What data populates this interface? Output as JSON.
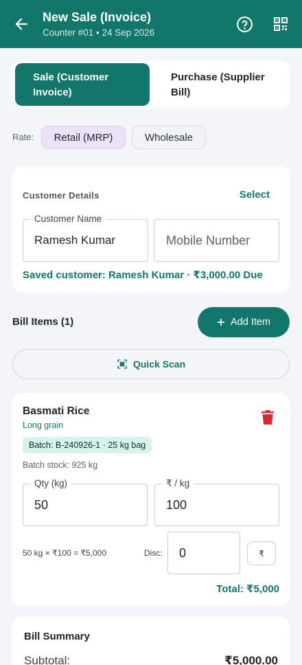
{
  "header": {
    "title": "New Sale (Invoice)",
    "subtitle": "Counter #01 • 24 Sep 2026",
    "icons": [
      "back-arrow-icon",
      "help-icon",
      "qr-code-icon"
    ]
  },
  "mode_tabs": [
    {
      "label": "Sale (Customer Invoice)",
      "active": true
    },
    {
      "label": "Purchase (Supplier Bill)",
      "active": false
    }
  ],
  "rate": {
    "label": "Rate:",
    "options": [
      {
        "label": "Retail (MRP)",
        "selected": true
      },
      {
        "label": "Wholesale",
        "selected": false
      }
    ]
  },
  "customer": {
    "section_title": "Customer Details",
    "select_label": "Select",
    "name_label": "Customer Name",
    "name_value": "Ramesh Kumar",
    "mobile_placeholder": "Mobile Number",
    "saved_text": "Saved customer: Ramesh Kumar · ₹3,000.00 Due"
  },
  "bill_items": {
    "title": "Bill Items (1)",
    "add_label": "Add Item",
    "quick_scan_label": "Quick Scan"
  },
  "items": [
    {
      "name": "Basmati Rice",
      "variant": "Long grain",
      "batch": "Batch: B-240926-1 · 25 kg bag",
      "stock": "Batch stock: 925 kg",
      "qty_label": "Qty (kg)",
      "qty_value": "50",
      "rate_label": "₹ / kg",
      "rate_value": "100",
      "calc": "50 kg × ₹100 = ₹5,000",
      "disc_label": "Disc:",
      "disc_value": "0",
      "disc_unit": "₹",
      "total": "Total: ₹5,000"
    }
  ],
  "summary": {
    "title": "Bill Summary",
    "subtotal_label": "Subtotal:",
    "subtotal_value": "₹5,000.00"
  },
  "colors": {
    "primary": "#12776a",
    "delete": "#d32f2f",
    "chip_selected": "#ece2f8",
    "batch_bg": "#d6f4ee"
  }
}
